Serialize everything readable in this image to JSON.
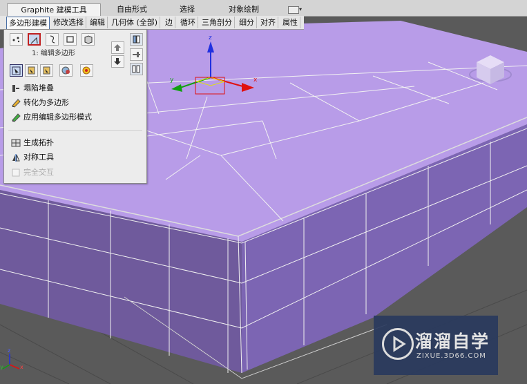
{
  "ribbon": {
    "tabs": [
      {
        "label": "Graphite 建模工具"
      },
      {
        "label": "自由形式"
      },
      {
        "label": "选择"
      },
      {
        "label": "对象绘制"
      }
    ],
    "dropdown": "▾"
  },
  "subtabs": [
    "多边形建模",
    "修改选择",
    "编辑",
    "几何体 (全部)",
    "边",
    "循环",
    "三角剖分",
    "细分",
    "对齐",
    "属性"
  ],
  "panel": {
    "hint": "1: 编辑多边形",
    "items": [
      {
        "label": "塌陷堆叠",
        "icon": "collapse-stack-icon"
      },
      {
        "label": "转化为多边形",
        "icon": "convert-to-poly-icon"
      },
      {
        "label": "应用编辑多边形模式",
        "icon": "apply-edit-poly-icon"
      },
      {
        "label": "生成拓扑",
        "icon": "generate-topology-icon"
      },
      {
        "label": "对称工具",
        "icon": "symmetry-tools-icon"
      },
      {
        "label": "完全交互",
        "icon": "checkbox-icon"
      }
    ]
  },
  "watermark": {
    "title": "溜溜自学",
    "url": "ZIXUE.3D66.COM"
  },
  "gizmo": {
    "x": "x",
    "y": "y",
    "z": "z"
  },
  "colors": {
    "mesh": "#b79be9",
    "mesh_side": "#8c74bb",
    "accent": "#4a6fa5"
  }
}
